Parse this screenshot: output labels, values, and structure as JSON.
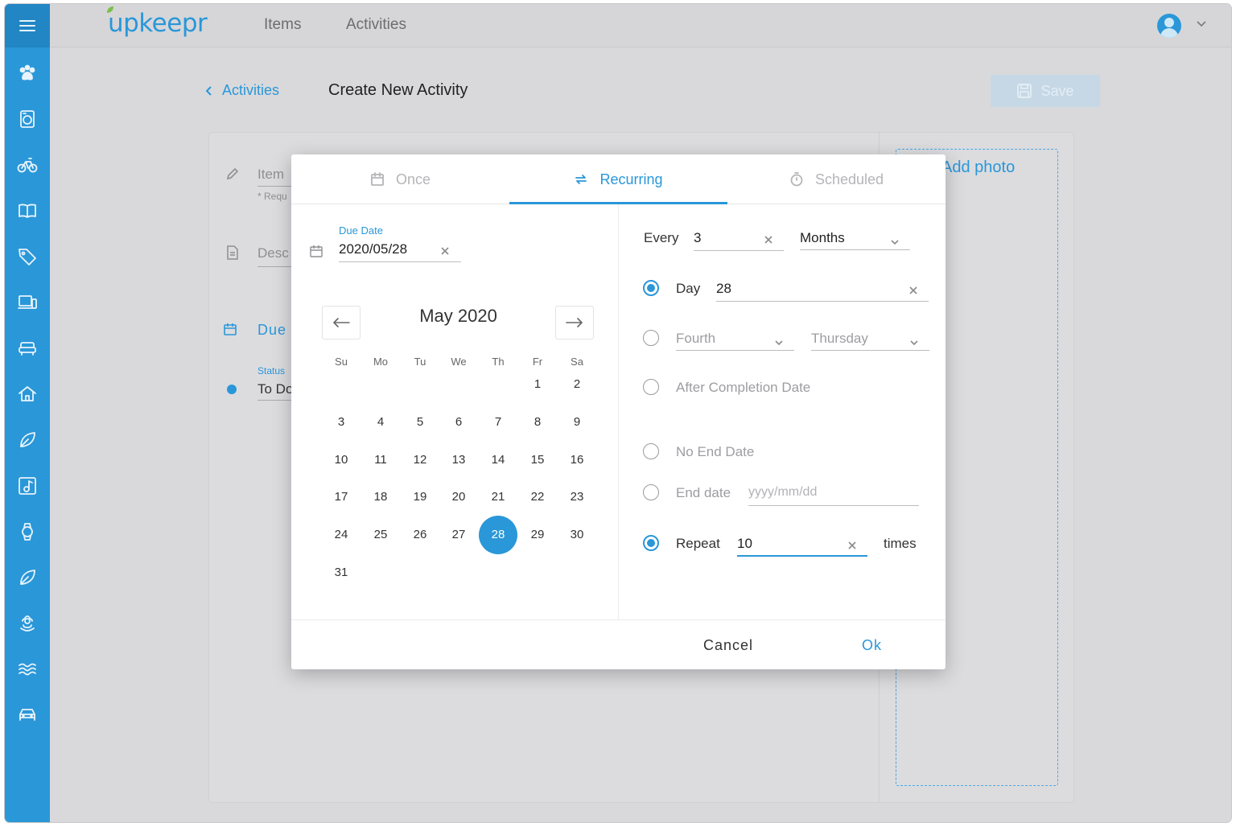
{
  "app": {
    "logo_text": "upkeepr",
    "brand_color": "#2a97d8"
  },
  "topnav": {
    "items_label": "Items",
    "activities_label": "Activities"
  },
  "sidebar": {
    "icons": [
      "menu-icon",
      "paw-icon",
      "washer-icon",
      "bicycle-icon",
      "book-icon",
      "tag-icon",
      "devices-icon",
      "sofa-icon",
      "home-icon",
      "leaf-icon",
      "music-icon",
      "watch-icon",
      "leaf-icon",
      "flower-icon",
      "water-icon",
      "car-icon"
    ]
  },
  "header": {
    "back_label": "Activities",
    "title": "Create New Activity",
    "save_label": "Save"
  },
  "background_form": {
    "item_label": "Item",
    "required_hint": "* Requ",
    "description_label": "Desc",
    "due_label": "Due",
    "status_label": "Status",
    "status_value": "To Do",
    "add_photo_label": "Add photo"
  },
  "modal": {
    "tabs": [
      {
        "label": "Once",
        "icon": "calendar-icon",
        "active": false
      },
      {
        "label": "Recurring",
        "icon": "repeat-icon",
        "active": true
      },
      {
        "label": "Scheduled",
        "icon": "timer-icon",
        "active": false
      }
    ],
    "due_date": {
      "label": "Due Date",
      "value": "2020/05/28"
    },
    "calendar": {
      "month_title": "May 2020",
      "weekdays": [
        "Su",
        "Mo",
        "Tu",
        "We",
        "Th",
        "Fr",
        "Sa"
      ],
      "start_weekday_index": 5,
      "days_in_month": 31,
      "selected_day": 28
    },
    "recurrence": {
      "every_label": "Every",
      "every_value": "3",
      "unit_value": "Months",
      "day_option": {
        "label": "Day",
        "value": "28",
        "selected": true
      },
      "nth_option": {
        "ordinal": "Fourth",
        "weekday": "Thursday",
        "selected": false
      },
      "after_completion_label": "After Completion Date",
      "no_end_label": "No End Date",
      "end_date_label": "End date",
      "end_date_placeholder": "yyyy/mm/dd",
      "repeat_label": "Repeat",
      "repeat_value": "10",
      "times_label": "times"
    },
    "footer": {
      "cancel_label": "Cancel",
      "ok_label": "Ok"
    }
  }
}
